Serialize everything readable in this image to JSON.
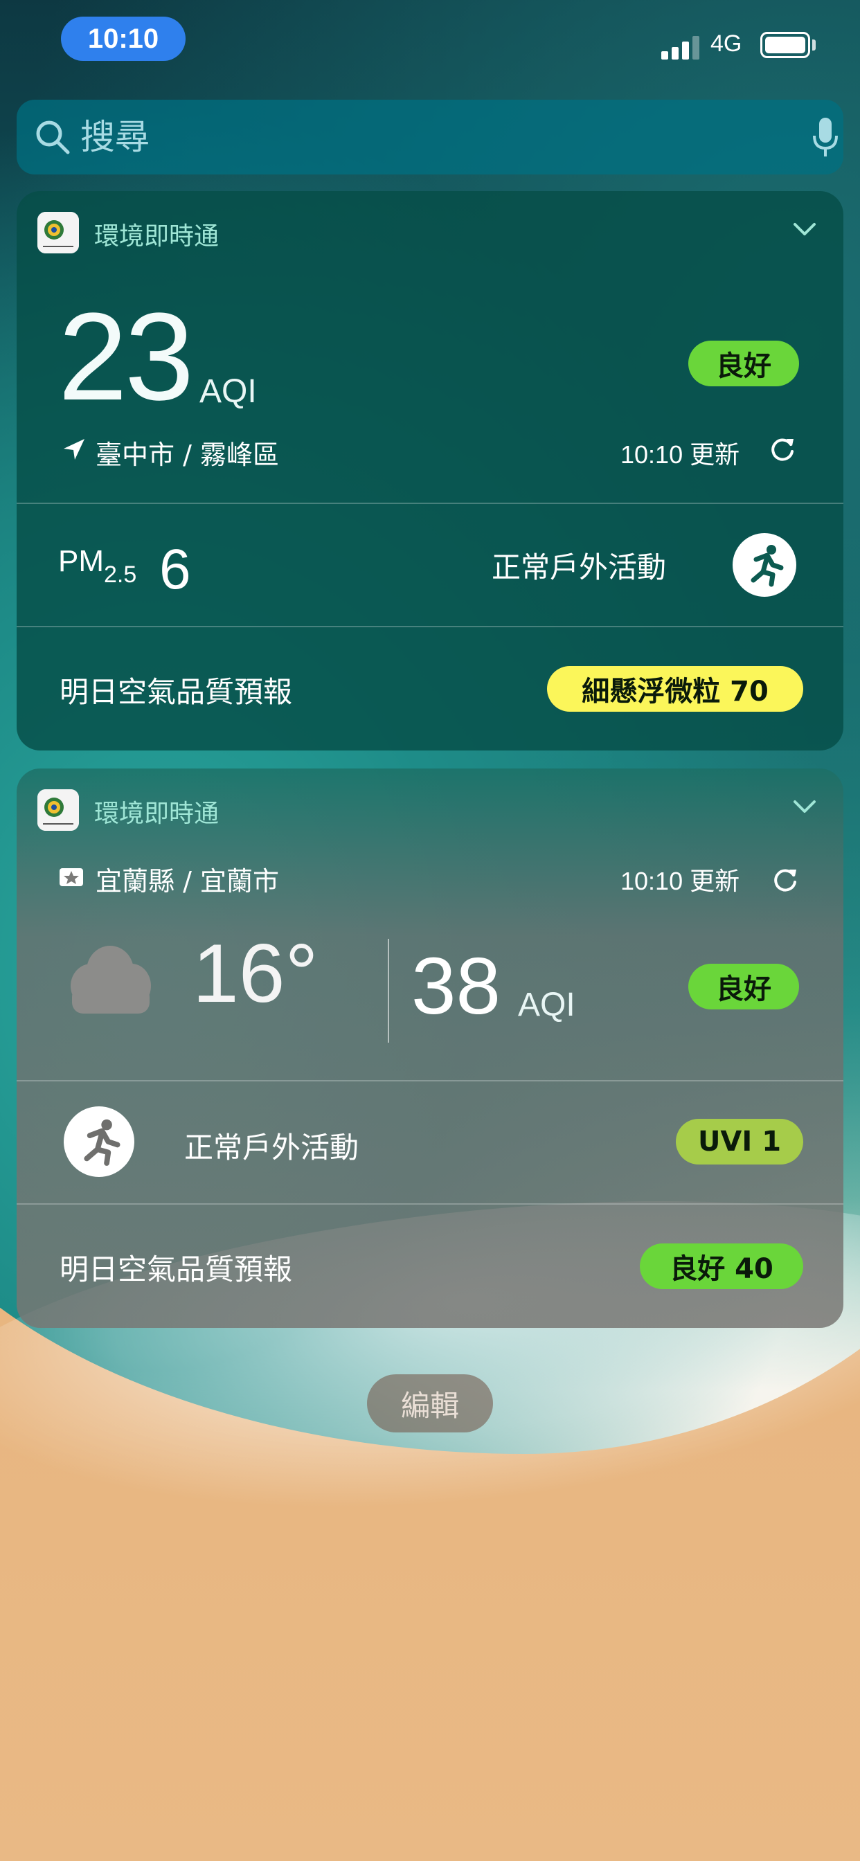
{
  "status_bar": {
    "time": "10:10",
    "network": "4G",
    "signal_bars": 3,
    "battery_level": 1.0
  },
  "search": {
    "placeholder": "搜尋",
    "icon": "search-icon",
    "mic_icon": "mic-icon"
  },
  "colors": {
    "time_pill": "#2f80ed",
    "badge_good": "#6ad63a",
    "badge_yellow": "#fbf65a",
    "badge_uvi": "#a6cc4a",
    "widget_1_bg": "#064e48"
  },
  "widget_1": {
    "app_name": "環境即時通",
    "aqi_value": "23",
    "aqi_unit": "AQI",
    "status_badge": "良好",
    "location": "臺中市 / 霧峰區",
    "update_text": "10:10 更新",
    "pm_label": "PM",
    "pm_subscript": "2.5",
    "pm_value": "6",
    "activity_text": "正常戶外活動",
    "forecast_label": "明日空氣品質預報",
    "forecast_badge": "細懸浮微粒 70"
  },
  "widget_2": {
    "app_name": "環境即時通",
    "location": "宜蘭縣 / 宜蘭市",
    "update_text": "10:10 更新",
    "temperature": "16°",
    "aqi_value": "38",
    "aqi_unit": "AQI",
    "status_badge": "良好",
    "activity_text": "正常戶外活動",
    "uvi_badge": "UVI 1",
    "forecast_label": "明日空氣品質預報",
    "forecast_badge": "良好 40"
  },
  "edit_button": "編輯"
}
